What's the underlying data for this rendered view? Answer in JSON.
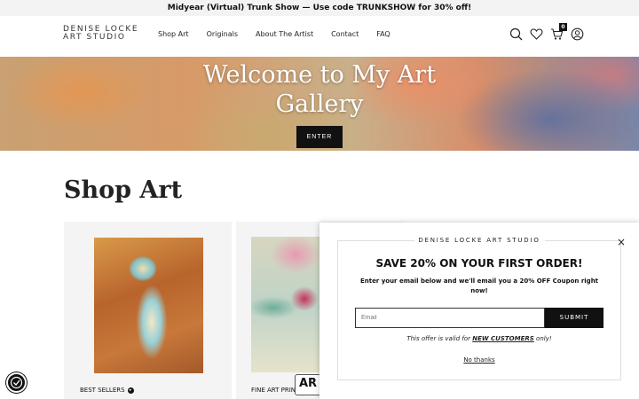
{
  "announcement": "Midyear (Virtual) Trunk Show — Use code TRUNKSHOW for 30% off!",
  "header": {
    "logo_line1": "DENISE LOCKE",
    "logo_line2": "ART STUDIO",
    "nav": [
      "Shop Art",
      "Originals",
      "About The Artist",
      "Contact",
      "FAQ"
    ],
    "icons": [
      "search-icon",
      "heart-icon",
      "cart-icon",
      "account-icon"
    ],
    "cart_count": "0"
  },
  "hero": {
    "title_line1": "Welcome to My Art",
    "title_line2": "Gallery",
    "button": "ENTER"
  },
  "shop": {
    "title": "Shop Art",
    "cards": [
      {
        "label": "BEST SELLERS"
      },
      {
        "label": "FINE ART PRIN"
      }
    ],
    "ar_badge": "AR"
  },
  "popup": {
    "brand": "DENISE LOCKE ART STUDIO",
    "close": "×",
    "headline": "SAVE 20% ON YOUR FIRST ORDER!",
    "description": "Enter your email below and we'll email you a 20% OFF Coupon right now!",
    "email_placeholder": "Email",
    "submit": "SUBMIT",
    "offer_prefix": "This offer is valid for ",
    "offer_emph": "NEW CUSTOMERS",
    "offer_suffix": " only!",
    "no_thanks": "No thanks"
  },
  "colors": {
    "dark": "#111111",
    "announce_bg": "#f3f3f3",
    "card_bg": "#f4f4f4"
  }
}
